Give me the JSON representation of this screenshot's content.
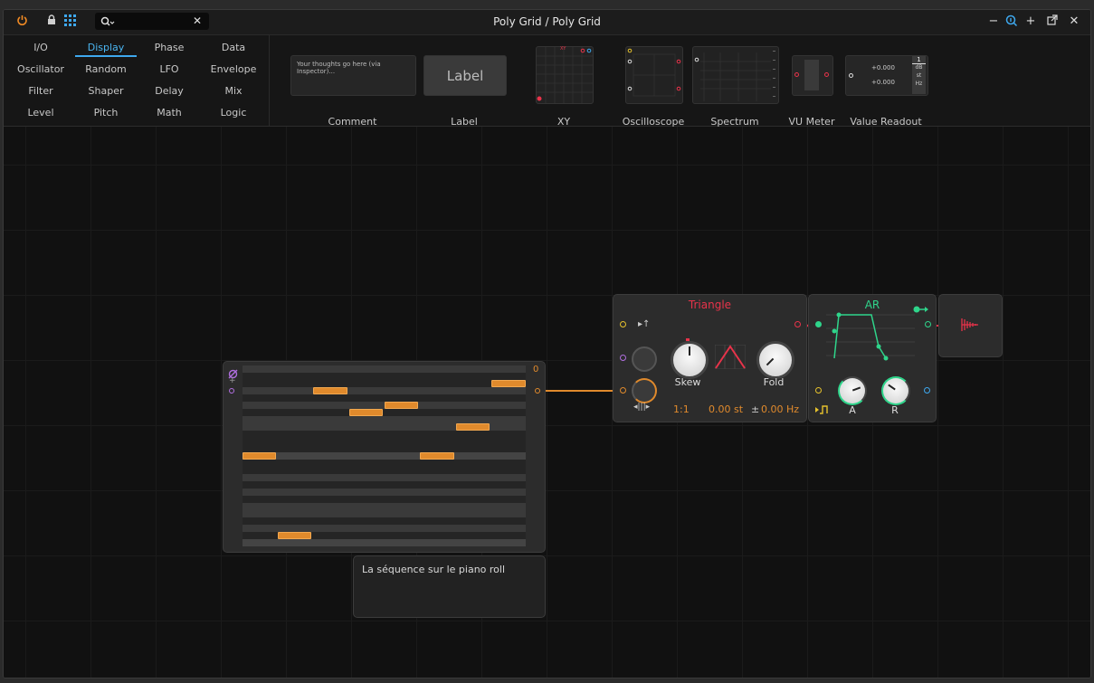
{
  "window": {
    "title": "Poly Grid / Poly Grid",
    "toolbar_icons": [
      "power-icon",
      "lock-icon",
      "grid-icon"
    ],
    "search": {
      "value": "",
      "clear_icon": "✕"
    },
    "controls": {
      "minimize": "−",
      "inspector": "i",
      "add": "+",
      "popout": "⇱",
      "close": "✕"
    }
  },
  "categories": [
    {
      "label": "I/O"
    },
    {
      "label": "Display",
      "active": true
    },
    {
      "label": "Phase"
    },
    {
      "label": "Data"
    },
    {
      "label": "Oscillator"
    },
    {
      "label": "Random"
    },
    {
      "label": "LFO"
    },
    {
      "label": "Envelope"
    },
    {
      "label": "Filter"
    },
    {
      "label": "Shaper"
    },
    {
      "label": "Delay"
    },
    {
      "label": "Mix"
    },
    {
      "label": "Level"
    },
    {
      "label": "Pitch"
    },
    {
      "label": "Math"
    },
    {
      "label": "Logic"
    }
  ],
  "display_modules": {
    "comment": {
      "label": "Comment",
      "preview_text": "Your thoughts go here (via Inspector)..."
    },
    "label": {
      "label": "Label",
      "preview_text": "Label"
    },
    "xy": {
      "label": "XY",
      "preview_text": "XY"
    },
    "oscilloscope": {
      "label": "Oscilloscope"
    },
    "spectrum": {
      "label": "Spectrum"
    },
    "vu_meter": {
      "label": "VU Meter"
    },
    "value_readout": {
      "label": "Value Readout",
      "val1": "+0.000",
      "val2": "+0.000",
      "unit_top": "1",
      "unit_db": "dB",
      "unit_st": "st",
      "unit_hz": "Hz"
    }
  },
  "piano_roll": {
    "counter": "0",
    "comment": "La séquence sur le piano roll"
  },
  "triangle": {
    "title": "Triangle",
    "skew_label": "Skew",
    "fold_label": "Fold",
    "ratio": "1:1",
    "pitch": "0.00 st",
    "pm": "±",
    "freq": "0.00 Hz"
  },
  "ar": {
    "title": "AR",
    "a_label": "A",
    "r_label": "R"
  },
  "colors": {
    "accent_blue": "#3ea8ee",
    "orange": "#e08a2c",
    "red": "#e8334a",
    "green": "#2fd58b",
    "yellow": "#e6c22d",
    "purple": "#b16fe0"
  }
}
